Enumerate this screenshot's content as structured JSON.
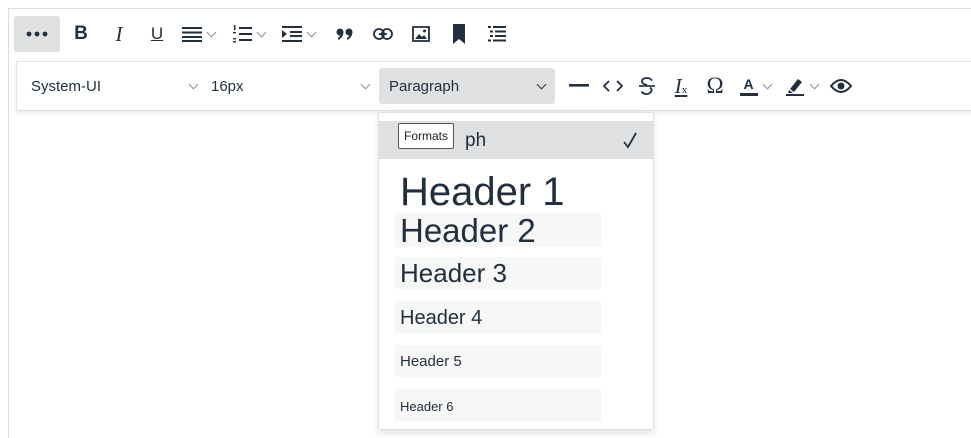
{
  "toolbar": {
    "more_icon": "ellipsis-icon",
    "bold_icon": "bold-icon",
    "italic_icon": "italic-icon",
    "underline_icon": "underline-icon",
    "align_icon": "align-justify-icon",
    "numlist_icon": "numbered-list-icon",
    "indent_icon": "indent-icon",
    "blockquote_icon": "blockquote-icon",
    "link_icon": "link-icon",
    "image_icon": "image-icon",
    "bookmark_icon": "bookmark-icon",
    "toc_icon": "table-of-contents-icon"
  },
  "toolbar2": {
    "font_family": "System-UI",
    "font_size": "16px",
    "block_format": "Paragraph",
    "italic_glyph": "I",
    "clear_suffix": "x",
    "special_char": "Ω",
    "text_color_glyph": "A",
    "accent_red": "#e03e2d"
  },
  "formats_menu": {
    "tooltip": "Formats",
    "selected_visible_text": "ph",
    "items": [
      {
        "label": "Paragraph",
        "selected": true
      },
      {
        "label": "Header 1"
      },
      {
        "label": "Header 2"
      },
      {
        "label": "Header 3"
      },
      {
        "label": "Header 4"
      },
      {
        "label": "Header 5"
      },
      {
        "label": "Header 6"
      }
    ]
  }
}
